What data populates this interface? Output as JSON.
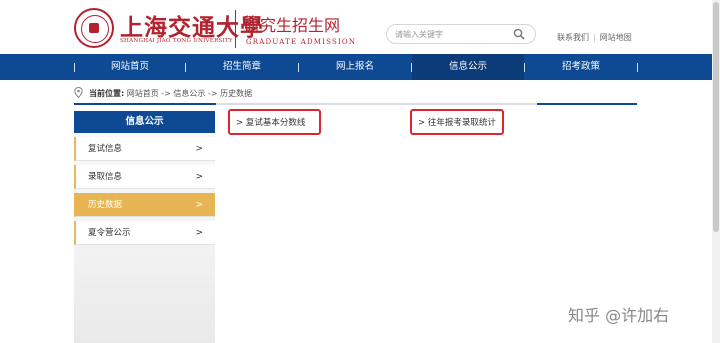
{
  "header": {
    "logo_cn": "上海交通大學",
    "logo_en": "SHANGHAI JIAO TONG UNIVERSITY",
    "site_cn": "研究生招生网",
    "site_en": "GRADUATE  ADMISSION",
    "search": {
      "placeholder": "请输入关键字",
      "icon": "search-icon"
    },
    "links": [
      "联系我们",
      "网站地图"
    ]
  },
  "nav": {
    "items": [
      {
        "label": "网站首页"
      },
      {
        "label": "招生简章"
      },
      {
        "label": "网上报名"
      },
      {
        "label": "信息公示"
      },
      {
        "label": "招考政策"
      }
    ],
    "active_index": 3,
    "color": "#0e4a94"
  },
  "breadcrumb": {
    "label": "当前位置:",
    "path": "网站首页 -> 信息公示 -> 历史数据"
  },
  "sidebar": {
    "title": "信息公示",
    "items": [
      {
        "label": "复试信息",
        "arrow": ">"
      },
      {
        "label": "录取信息",
        "arrow": ">"
      },
      {
        "label": "历史数据",
        "arrow": ">"
      },
      {
        "label": "夏令营公示",
        "arrow": ">"
      }
    ],
    "active_index": 2,
    "accent_color": "#e7b453"
  },
  "content": {
    "links": [
      {
        "label": "> 复试基本分数线"
      },
      {
        "label": "> 往年报考录取统计"
      }
    ],
    "highlight_color": "#d9262f"
  },
  "watermark": "知乎 @许加右"
}
